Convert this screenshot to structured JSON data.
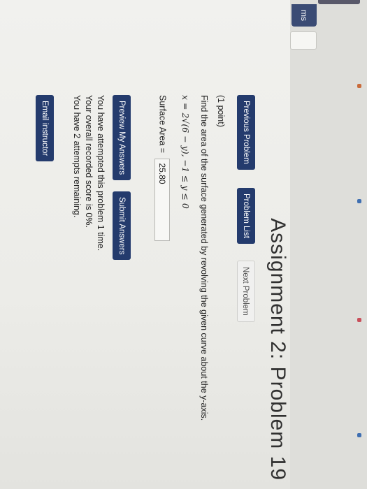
{
  "page": {
    "heading": "Assignment 2: Problem 19",
    "sidebar_label": "ms"
  },
  "nav": {
    "previous": "Previous Problem",
    "problem_list": "Problem List",
    "next": "Next Problem"
  },
  "problem": {
    "points": "(1 point)",
    "prompt": "Find the area of the surface generated by revolving the given curve about the y-axis.",
    "equation": "x = 2√(6 − y),  −1 ≤ y ≤ 0",
    "answer_label": "Surface Area =",
    "answer_value": "25.80"
  },
  "actions": {
    "preview": "Preview My Answers",
    "submit": "Submit Answers"
  },
  "status": {
    "attempts": "You have attempted this problem 1 time.",
    "score": "Your overall recorded score is 0%.",
    "remaining": "You have 2 attempts remaining."
  },
  "email": "Email instructor",
  "colors": {
    "primary_button": "#243b6d",
    "page_bg": "#ecece8"
  }
}
